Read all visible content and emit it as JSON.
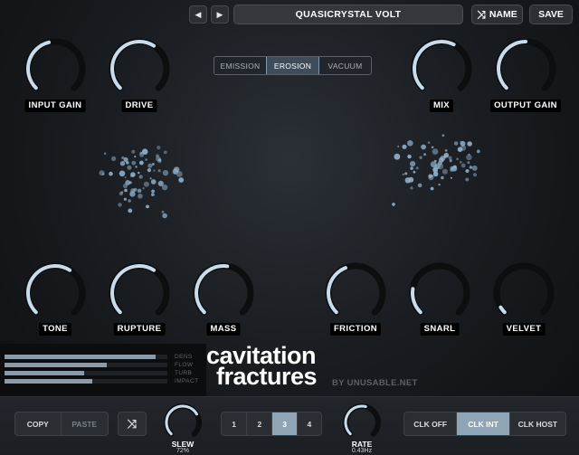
{
  "header": {
    "prev_icon": "◀",
    "next_icon": "▶",
    "preset_name": "QUASICRYSTAL VOLT",
    "shuffle_icon": "⤨",
    "name_label": "NAME",
    "save_label": "SAVE"
  },
  "modes": {
    "items": [
      {
        "label": "EMISSION",
        "active": false
      },
      {
        "label": "EROSION",
        "active": true
      },
      {
        "label": "VACUUM",
        "active": false
      }
    ]
  },
  "knobs": {
    "input_gain": {
      "label": "INPUT GAIN",
      "value": 0.45
    },
    "drive": {
      "label": "DRIVE",
      "value": 0.62
    },
    "mix": {
      "label": "MIX",
      "value": 0.6
    },
    "output_gain": {
      "label": "OUTPUT GAIN",
      "value": 0.5
    },
    "tone": {
      "label": "TONE",
      "value": 0.62
    },
    "rupture": {
      "label": "RUPTURE",
      "value": 0.62
    },
    "mass": {
      "label": "MASS",
      "value": 0.53
    },
    "friction": {
      "label": "FRICTION",
      "value": 0.42
    },
    "snarl": {
      "label": "SNARL",
      "value": 0.2
    },
    "velvet": {
      "label": "VELVET",
      "value": 0.05
    }
  },
  "meters": [
    {
      "label": "DENS",
      "value": 0.93
    },
    {
      "label": "FLOW",
      "value": 0.63
    },
    {
      "label": "TURB",
      "value": 0.49
    },
    {
      "label": "IMPACT",
      "value": 0.54
    }
  ],
  "brand": {
    "line1": "cavitation",
    "line2": "fractures",
    "byline": "BY UNUSABLE.NET"
  },
  "bottom": {
    "copy_label": "COPY",
    "paste_label": "PASTE",
    "random_icon": "⤨",
    "slew": {
      "label": "SLEW",
      "value_text": "72%",
      "value": 0.72
    },
    "slots": [
      {
        "label": "1",
        "active": false
      },
      {
        "label": "2",
        "active": false
      },
      {
        "label": "3",
        "active": true
      },
      {
        "label": "4",
        "active": false
      }
    ],
    "rate": {
      "label": "RATE",
      "value_text": "0.43Hz",
      "value": 0.55
    },
    "clock": [
      {
        "label": "CLK OFF",
        "active": false
      },
      {
        "label": "CLK INT",
        "active": true
      },
      {
        "label": "CLK HOST",
        "active": false
      }
    ]
  },
  "colors": {
    "accent": "#c9dcec",
    "knob_track": "#0c0e10",
    "active_button": "#8fa4b5"
  }
}
